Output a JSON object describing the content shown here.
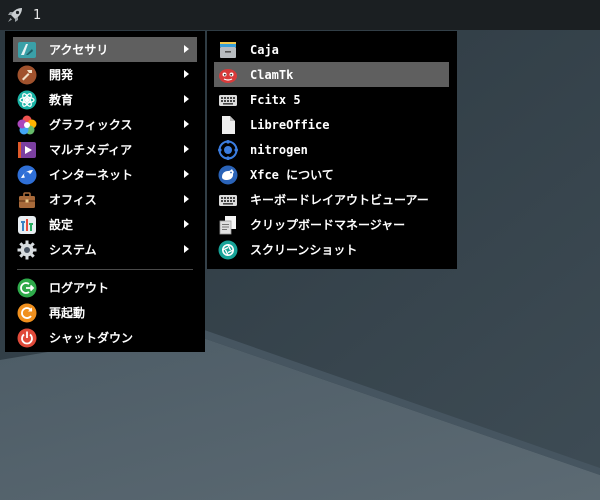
{
  "panel": {
    "launcher_icon": "rocket-icon",
    "workspace": "1"
  },
  "menu": {
    "categories": [
      {
        "label": "アクセサリ",
        "icon": "accessories-icon",
        "has_submenu": true,
        "active": true
      },
      {
        "label": "開発",
        "icon": "development-icon",
        "has_submenu": true
      },
      {
        "label": "教育",
        "icon": "education-icon",
        "has_submenu": true
      },
      {
        "label": "グラフィックス",
        "icon": "graphics-icon",
        "has_submenu": true
      },
      {
        "label": "マルチメディア",
        "icon": "multimedia-icon",
        "has_submenu": true
      },
      {
        "label": "インターネット",
        "icon": "internet-icon",
        "has_submenu": true
      },
      {
        "label": "オフィス",
        "icon": "office-icon",
        "has_submenu": true
      },
      {
        "label": "設定",
        "icon": "settings-icon",
        "has_submenu": true
      },
      {
        "label": "システム",
        "icon": "system-icon",
        "has_submenu": true
      }
    ],
    "actions": [
      {
        "label": "ログアウト",
        "icon": "logout-icon"
      },
      {
        "label": "再起動",
        "icon": "restart-icon"
      },
      {
        "label": "シャットダウン",
        "icon": "shutdown-icon"
      }
    ]
  },
  "submenu": {
    "items": [
      {
        "label": "Caja",
        "icon": "file-manager-icon"
      },
      {
        "label": "ClamTk",
        "icon": "clamtk-icon",
        "active": true
      },
      {
        "label": "Fcitx 5",
        "icon": "keyboard-icon"
      },
      {
        "label": "LibreOffice",
        "icon": "document-icon"
      },
      {
        "label": "nitrogen",
        "icon": "nitrogen-icon"
      },
      {
        "label": "Xfce について",
        "icon": "xfce-icon"
      },
      {
        "label": "キーボードレイアウトビューアー",
        "icon": "keyboard-icon"
      },
      {
        "label": "クリップボードマネージャー",
        "icon": "clipboard-icon"
      },
      {
        "label": "スクリーンショット",
        "icon": "screenshot-icon"
      }
    ]
  },
  "colors": {
    "panel": "#1b1f22",
    "menu_bg": "#000000",
    "highlight": "#5f5f5f",
    "desktop_dark": "#2f3b43",
    "desktop_light": "#56656e"
  }
}
